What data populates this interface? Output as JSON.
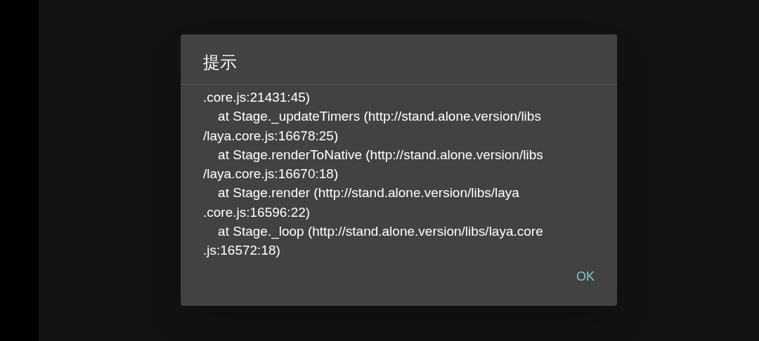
{
  "dialog": {
    "title": "提示",
    "message": ".core.js:21431:45)\n    at Stage._updateTimers (http://stand.alone.version/libs\n/laya.core.js:16678:25)\n    at Stage.renderToNative (http://stand.alone.version/libs\n/laya.core.js:16670:18)\n    at Stage.render (http://stand.alone.version/libs/laya\n.core.js:16596:22)\n    at Stage._loop (http://stand.alone.version/libs/laya.core\n.js:16572:18)",
    "buttons": [
      "OK"
    ]
  }
}
